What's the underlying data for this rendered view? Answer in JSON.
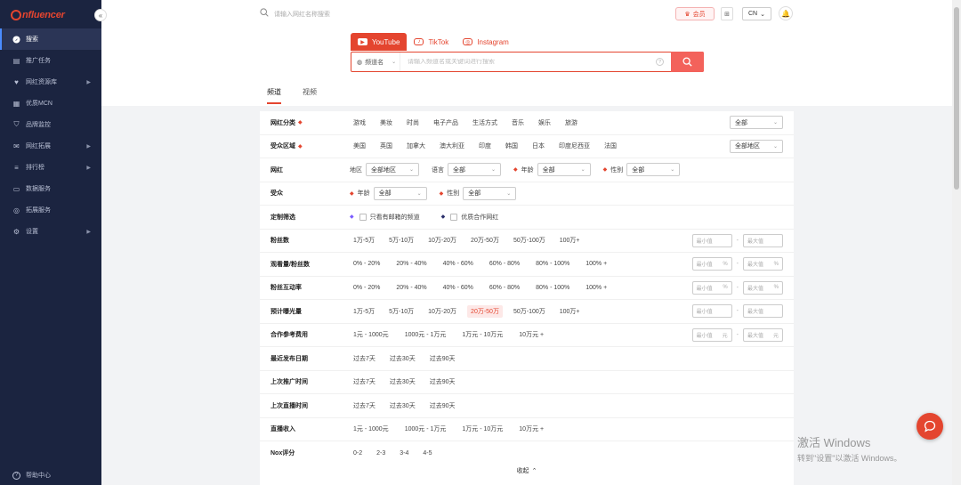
{
  "brand": {
    "logo_text": "nfluencer",
    "accent": "#e4452f",
    "sidebar_bg": "#1b2440"
  },
  "sidebar": {
    "collapse_icon": "«",
    "items": [
      {
        "label": "搜索",
        "icon": "search-icon",
        "active": true
      },
      {
        "label": "推广任务",
        "icon": "task-icon"
      },
      {
        "label": "网红资源库",
        "icon": "heart-icon",
        "arrow": "▶"
      },
      {
        "label": "优质MCN",
        "icon": "mcn-icon"
      },
      {
        "label": "品牌监控",
        "icon": "shield-icon"
      },
      {
        "label": "网红拓展",
        "icon": "mail-icon",
        "arrow": "▶"
      },
      {
        "label": "排行榜",
        "icon": "ranking-icon",
        "arrow": "▶"
      },
      {
        "label": "数据服务",
        "icon": "data-icon"
      },
      {
        "label": "拓展服务",
        "icon": "extend-icon"
      },
      {
        "label": "设置",
        "icon": "gear-icon",
        "arrow": "▶"
      }
    ],
    "help": "帮助中心"
  },
  "topbar": {
    "search_placeholder": "请输入网红名称搜索",
    "vip": "会员",
    "grid_icon": "⊞",
    "lang": "CN"
  },
  "platform_tabs": [
    {
      "label": "YouTube",
      "active": true
    },
    {
      "label": "TikTok"
    },
    {
      "label": "Instagram"
    }
  ],
  "search": {
    "scope": "频道名",
    "placeholder": "请输入频道名或关键词进行搜索"
  },
  "content_tabs": [
    {
      "label": "频道",
      "active": true
    },
    {
      "label": "视频"
    }
  ],
  "filters": {
    "category": {
      "label": "网红分类",
      "options": [
        "游戏",
        "美妆",
        "时尚",
        "电子产品",
        "生活方式",
        "音乐",
        "娱乐",
        "旅游"
      ],
      "select": "全部"
    },
    "audience_region": {
      "label": "受众区域",
      "options": [
        "美国",
        "英国",
        "加拿大",
        "澳大利亚",
        "印度",
        "韩国",
        "日本",
        "印度尼西亚",
        "法国"
      ],
      "select": "全部地区"
    },
    "influencer": {
      "label": "网红",
      "region_label": "地区",
      "region_value": "全部地区",
      "lang_label": "语言",
      "lang_value": "全部",
      "age_label": "年龄",
      "age_value": "全部",
      "gender_label": "性别",
      "gender_value": "全部"
    },
    "audience": {
      "label": "受众",
      "age_label": "年龄",
      "age_value": "全部",
      "gender_label": "性别",
      "gender_value": "全部"
    },
    "custom": {
      "label": "定制筛选",
      "opt1": "只看有邮箱的频道",
      "opt2": "优质合作网红"
    },
    "followers": {
      "label": "粉丝数",
      "options": [
        "1万-5万",
        "5万-10万",
        "10万-20万",
        "20万-50万",
        "50万-100万",
        "100万+"
      ],
      "min": "最小值",
      "max": "最大值"
    },
    "view_ratio": {
      "label": "观看量/粉丝数",
      "options": [
        "0% - 20%",
        "20% - 40%",
        "40% - 60%",
        "60% - 80%",
        "80% - 100%",
        "100% +"
      ],
      "min": "最小值",
      "max": "最大值",
      "unit": "%"
    },
    "engagement": {
      "label": "粉丝互动率",
      "options": [
        "0% - 20%",
        "20% - 40%",
        "40% - 60%",
        "60% - 80%",
        "80% - 100%",
        "100% +"
      ],
      "min": "最小值",
      "max": "最大值",
      "unit": "%"
    },
    "exposure": {
      "label": "预计曝光量",
      "options": [
        "1万-5万",
        "5万-10万",
        "10万-20万",
        "20万-50万",
        "50万-100万",
        "100万+"
      ],
      "selected": "20万-50万",
      "min": "最小值",
      "max": "最大值"
    },
    "cost": {
      "label": "合作参考费用",
      "options": [
        "1元 - 1000元",
        "1000元 - 1万元",
        "1万元 - 10万元",
        "10万元 +"
      ],
      "min": "最小值",
      "max": "最大值",
      "unit": "元"
    },
    "last_post": {
      "label": "最近发布日期",
      "options": [
        "过去7天",
        "过去30天",
        "过去90天"
      ]
    },
    "last_promo": {
      "label": "上次推广时间",
      "options": [
        "过去7天",
        "过去30天",
        "过去90天"
      ]
    },
    "last_live": {
      "label": "上次直播时间",
      "options": [
        "过去7天",
        "过去30天",
        "过去90天"
      ]
    },
    "live_income": {
      "label": "直播收入",
      "options": [
        "1元 - 1000元",
        "1000元 - 1万元",
        "1万元 - 10万元",
        "10万元 +"
      ]
    },
    "nox_score": {
      "label": "Nox评分",
      "options": [
        "0-2",
        "2-3",
        "3-4",
        "4-5"
      ]
    },
    "collapse": "收起"
  },
  "watermark": {
    "title": "激活 Windows",
    "sub": "转到\"设置\"以激活 Windows。"
  }
}
